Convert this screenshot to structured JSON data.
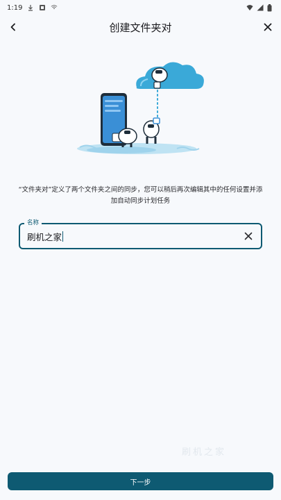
{
  "status_bar": {
    "time": "1:19",
    "left_icons": [
      "download-icon",
      "app-notification-icon",
      "cast-icon"
    ],
    "right_icons": [
      "wifi-icon",
      "signal-icon",
      "battery-icon"
    ]
  },
  "app_bar": {
    "title": "创建文件夹对",
    "back_icon": "chevron-left-icon",
    "close_icon": "close-icon"
  },
  "description": "“文件夹对”定义了两个文件夹之间的同步，您可以稍后再次编辑其中的任何设置并添加自动同步计划任务",
  "name_field": {
    "label": "名称",
    "value": "刷机之家",
    "clear_icon": "clear-icon"
  },
  "watermark": "刷机之家",
  "next_button": {
    "label": "下一步"
  },
  "colors": {
    "accent": "#0e5a72",
    "background": "#f7f9fc",
    "cloud": "#3aa9d8"
  }
}
